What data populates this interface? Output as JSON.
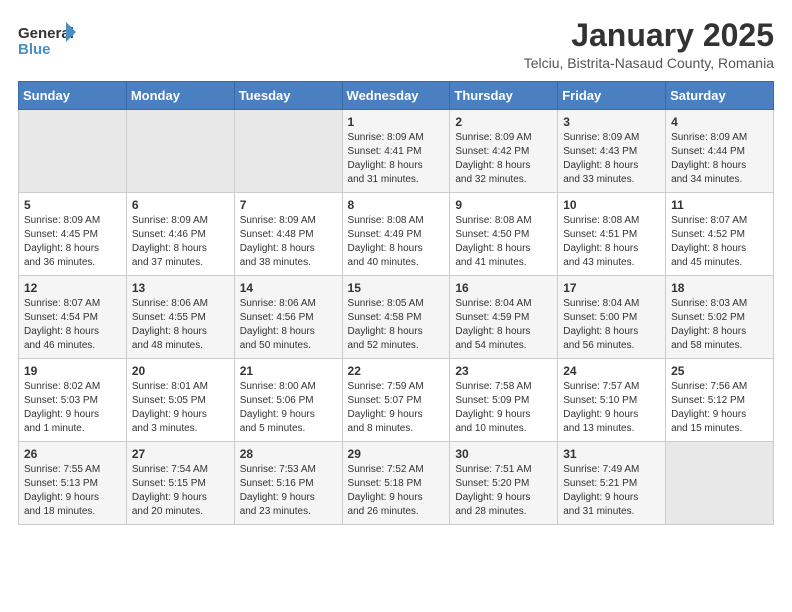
{
  "logo": {
    "line1": "General",
    "line2": "Blue"
  },
  "title": "January 2025",
  "location": "Telciu, Bistrita-Nasaud County, Romania",
  "header": {
    "days": [
      "Sunday",
      "Monday",
      "Tuesday",
      "Wednesday",
      "Thursday",
      "Friday",
      "Saturday"
    ]
  },
  "weeks": [
    [
      {
        "day": "",
        "info": ""
      },
      {
        "day": "",
        "info": ""
      },
      {
        "day": "",
        "info": ""
      },
      {
        "day": "1",
        "info": "Sunrise: 8:09 AM\nSunset: 4:41 PM\nDaylight: 8 hours\nand 31 minutes."
      },
      {
        "day": "2",
        "info": "Sunrise: 8:09 AM\nSunset: 4:42 PM\nDaylight: 8 hours\nand 32 minutes."
      },
      {
        "day": "3",
        "info": "Sunrise: 8:09 AM\nSunset: 4:43 PM\nDaylight: 8 hours\nand 33 minutes."
      },
      {
        "day": "4",
        "info": "Sunrise: 8:09 AM\nSunset: 4:44 PM\nDaylight: 8 hours\nand 34 minutes."
      }
    ],
    [
      {
        "day": "5",
        "info": "Sunrise: 8:09 AM\nSunset: 4:45 PM\nDaylight: 8 hours\nand 36 minutes."
      },
      {
        "day": "6",
        "info": "Sunrise: 8:09 AM\nSunset: 4:46 PM\nDaylight: 8 hours\nand 37 minutes."
      },
      {
        "day": "7",
        "info": "Sunrise: 8:09 AM\nSunset: 4:48 PM\nDaylight: 8 hours\nand 38 minutes."
      },
      {
        "day": "8",
        "info": "Sunrise: 8:08 AM\nSunset: 4:49 PM\nDaylight: 8 hours\nand 40 minutes."
      },
      {
        "day": "9",
        "info": "Sunrise: 8:08 AM\nSunset: 4:50 PM\nDaylight: 8 hours\nand 41 minutes."
      },
      {
        "day": "10",
        "info": "Sunrise: 8:08 AM\nSunset: 4:51 PM\nDaylight: 8 hours\nand 43 minutes."
      },
      {
        "day": "11",
        "info": "Sunrise: 8:07 AM\nSunset: 4:52 PM\nDaylight: 8 hours\nand 45 minutes."
      }
    ],
    [
      {
        "day": "12",
        "info": "Sunrise: 8:07 AM\nSunset: 4:54 PM\nDaylight: 8 hours\nand 46 minutes."
      },
      {
        "day": "13",
        "info": "Sunrise: 8:06 AM\nSunset: 4:55 PM\nDaylight: 8 hours\nand 48 minutes."
      },
      {
        "day": "14",
        "info": "Sunrise: 8:06 AM\nSunset: 4:56 PM\nDaylight: 8 hours\nand 50 minutes."
      },
      {
        "day": "15",
        "info": "Sunrise: 8:05 AM\nSunset: 4:58 PM\nDaylight: 8 hours\nand 52 minutes."
      },
      {
        "day": "16",
        "info": "Sunrise: 8:04 AM\nSunset: 4:59 PM\nDaylight: 8 hours\nand 54 minutes."
      },
      {
        "day": "17",
        "info": "Sunrise: 8:04 AM\nSunset: 5:00 PM\nDaylight: 8 hours\nand 56 minutes."
      },
      {
        "day": "18",
        "info": "Sunrise: 8:03 AM\nSunset: 5:02 PM\nDaylight: 8 hours\nand 58 minutes."
      }
    ],
    [
      {
        "day": "19",
        "info": "Sunrise: 8:02 AM\nSunset: 5:03 PM\nDaylight: 9 hours\nand 1 minute."
      },
      {
        "day": "20",
        "info": "Sunrise: 8:01 AM\nSunset: 5:05 PM\nDaylight: 9 hours\nand 3 minutes."
      },
      {
        "day": "21",
        "info": "Sunrise: 8:00 AM\nSunset: 5:06 PM\nDaylight: 9 hours\nand 5 minutes."
      },
      {
        "day": "22",
        "info": "Sunrise: 7:59 AM\nSunset: 5:07 PM\nDaylight: 9 hours\nand 8 minutes."
      },
      {
        "day": "23",
        "info": "Sunrise: 7:58 AM\nSunset: 5:09 PM\nDaylight: 9 hours\nand 10 minutes."
      },
      {
        "day": "24",
        "info": "Sunrise: 7:57 AM\nSunset: 5:10 PM\nDaylight: 9 hours\nand 13 minutes."
      },
      {
        "day": "25",
        "info": "Sunrise: 7:56 AM\nSunset: 5:12 PM\nDaylight: 9 hours\nand 15 minutes."
      }
    ],
    [
      {
        "day": "26",
        "info": "Sunrise: 7:55 AM\nSunset: 5:13 PM\nDaylight: 9 hours\nand 18 minutes."
      },
      {
        "day": "27",
        "info": "Sunrise: 7:54 AM\nSunset: 5:15 PM\nDaylight: 9 hours\nand 20 minutes."
      },
      {
        "day": "28",
        "info": "Sunrise: 7:53 AM\nSunset: 5:16 PM\nDaylight: 9 hours\nand 23 minutes."
      },
      {
        "day": "29",
        "info": "Sunrise: 7:52 AM\nSunset: 5:18 PM\nDaylight: 9 hours\nand 26 minutes."
      },
      {
        "day": "30",
        "info": "Sunrise: 7:51 AM\nSunset: 5:20 PM\nDaylight: 9 hours\nand 28 minutes."
      },
      {
        "day": "31",
        "info": "Sunrise: 7:49 AM\nSunset: 5:21 PM\nDaylight: 9 hours\nand 31 minutes."
      },
      {
        "day": "",
        "info": ""
      }
    ]
  ]
}
